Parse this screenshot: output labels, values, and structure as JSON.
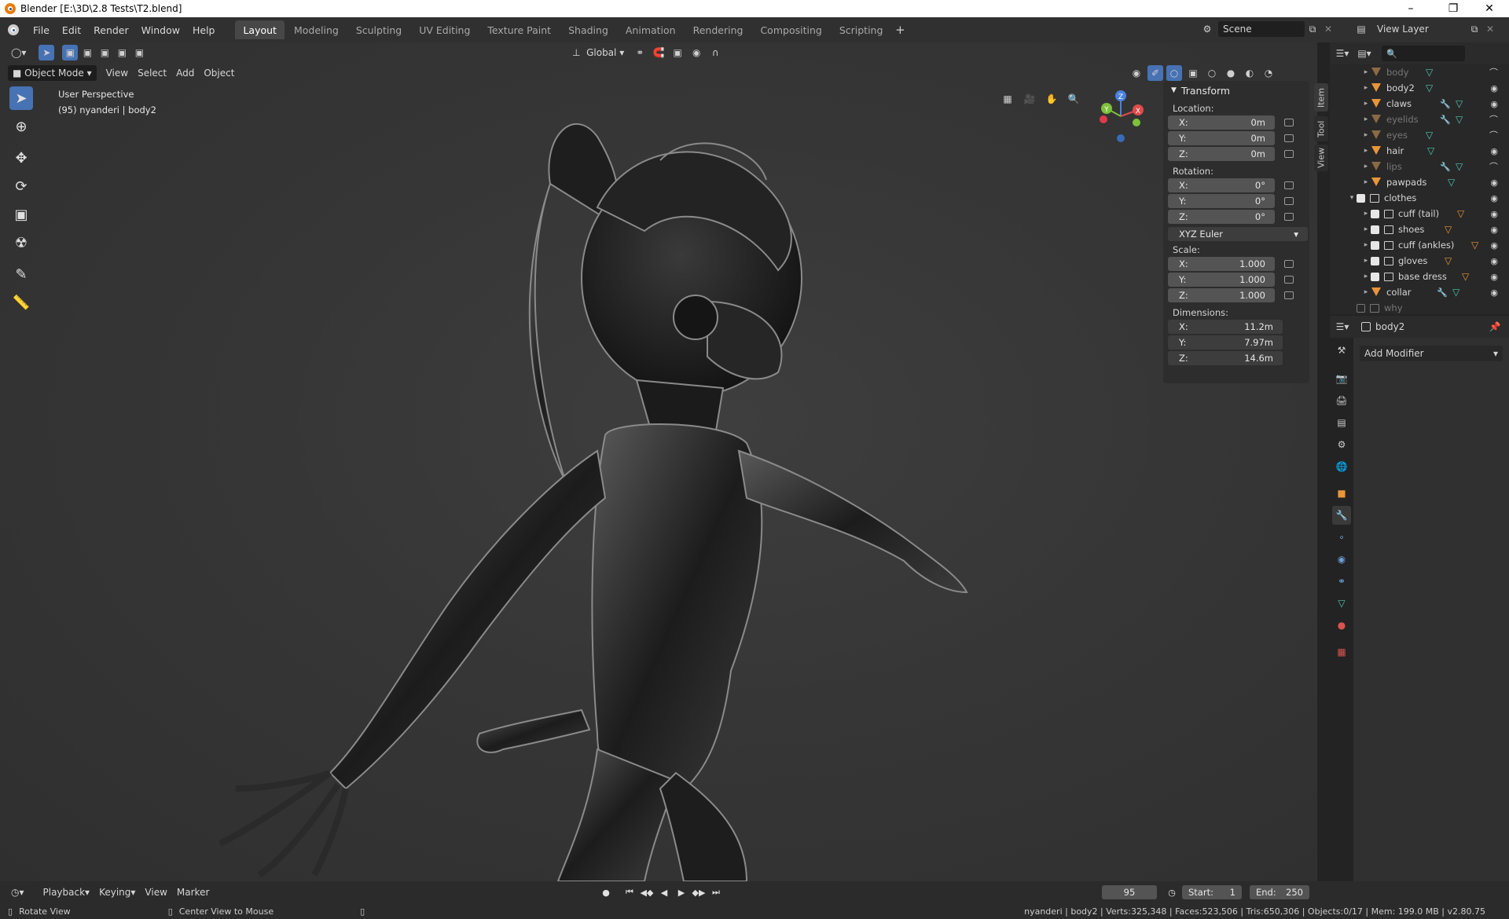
{
  "window": {
    "title": "Blender [E:\\3D\\2.8 Tests\\T2.blend]"
  },
  "menu": [
    "File",
    "Edit",
    "Render",
    "Window",
    "Help"
  ],
  "workspaces": [
    "Layout",
    "Modeling",
    "Sculpting",
    "UV Editing",
    "Texture Paint",
    "Shading",
    "Animation",
    "Rendering",
    "Compositing",
    "Scripting"
  ],
  "scene": {
    "name": "Scene",
    "view_layer": "View Layer"
  },
  "header": {
    "transform_orientation": "Global",
    "mode": "Object Mode",
    "menus": [
      "View",
      "Select",
      "Add",
      "Object"
    ]
  },
  "viewport": {
    "perspective": "User Perspective",
    "object_info": "(95) nyanderi | body2",
    "gizmo": {
      "z": "Z",
      "y": "Y",
      "x": "X"
    }
  },
  "npanel": {
    "title": "Transform",
    "tabs": [
      "Item",
      "Tool",
      "View"
    ],
    "location_label": "Location:",
    "location": [
      {
        "axis": "X:",
        "value": "0m"
      },
      {
        "axis": "Y:",
        "value": "0m"
      },
      {
        "axis": "Z:",
        "value": "0m"
      }
    ],
    "rotation_label": "Rotation:",
    "rotation": [
      {
        "axis": "X:",
        "value": "0°"
      },
      {
        "axis": "Y:",
        "value": "0°"
      },
      {
        "axis": "Z:",
        "value": "0°"
      }
    ],
    "rotation_mode": "XYZ Euler",
    "scale_label": "Scale:",
    "scale": [
      {
        "axis": "X:",
        "value": "1.000"
      },
      {
        "axis": "Y:",
        "value": "1.000"
      },
      {
        "axis": "Z:",
        "value": "1.000"
      }
    ],
    "dimensions_label": "Dimensions:",
    "dimensions": [
      {
        "axis": "X:",
        "value": "11.2m"
      },
      {
        "axis": "Y:",
        "value": "7.97m"
      },
      {
        "axis": "Z:",
        "value": "14.6m"
      }
    ]
  },
  "outliner": {
    "items": [
      {
        "name": "body",
        "dim": true
      },
      {
        "name": "body2",
        "dim": false
      },
      {
        "name": "claws",
        "dim": false
      },
      {
        "name": "eyelids",
        "dim": true
      },
      {
        "name": "eyes",
        "dim": true
      },
      {
        "name": "hair",
        "dim": false
      },
      {
        "name": "lips",
        "dim": true
      },
      {
        "name": "pawpads",
        "dim": false
      }
    ],
    "collection": "clothes",
    "children": [
      "cuff (tail)",
      "shoes",
      "cuff (ankles)",
      "gloves",
      "base dress",
      "collar"
    ],
    "last": "why"
  },
  "properties": {
    "object": "body2",
    "add_modifier": "Add Modifier"
  },
  "timeline": {
    "menus": [
      "Playback",
      "Keying",
      "View",
      "Marker"
    ],
    "current_frame": "95",
    "start_label": "Start:",
    "start": "1",
    "end_label": "End:",
    "end": "250"
  },
  "status": {
    "left1": "Rotate View",
    "left2": "Center View to Mouse",
    "right": "nyanderi | body2 | Verts:325,348 | Faces:523,506 | Tris:650,306 | Objects:0/17 | Mem: 199.0 MB | v2.80.75"
  },
  "colors": {
    "accent": "#4772b3",
    "mesh_icon": "#4ec9b0",
    "object_icon": "#e8953a"
  }
}
